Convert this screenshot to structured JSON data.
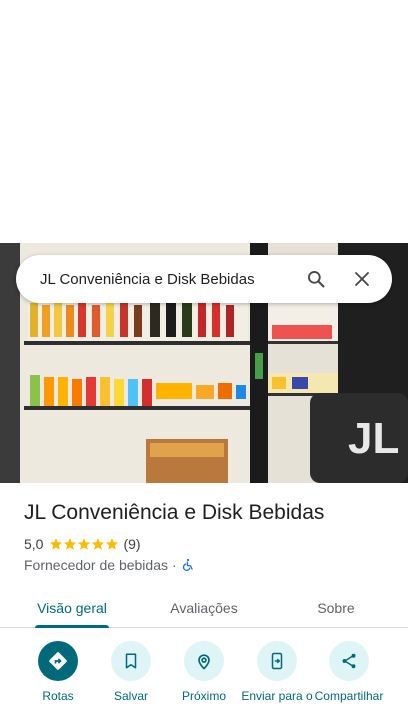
{
  "search": {
    "query": "JL Conveniência e Disk Bebidas"
  },
  "place": {
    "name": "JL Conveniência e Disk Bebidas",
    "rating": "5,0",
    "stars": 5,
    "review_count": "(9)",
    "category": "Fornecedor de bebidas",
    "separator": "·"
  },
  "tabs": [
    {
      "label": "Visão geral",
      "active": true
    },
    {
      "label": "Avaliações",
      "active": false
    },
    {
      "label": "Sobre",
      "active": false
    }
  ],
  "actions": [
    {
      "label": "Rotas",
      "icon": "directions-icon"
    },
    {
      "label": "Salvar",
      "icon": "bookmark-icon"
    },
    {
      "label": "Próximo",
      "icon": "nearby-icon"
    },
    {
      "label": "Enviar para o",
      "icon": "send-to-phone-icon"
    },
    {
      "label": "Compartilhar",
      "icon": "share-icon"
    }
  ],
  "colors": {
    "accent": "#00697a",
    "accent_light": "#dff4f7",
    "star": "#fbbc04",
    "accessibility": "#1a73e8"
  }
}
